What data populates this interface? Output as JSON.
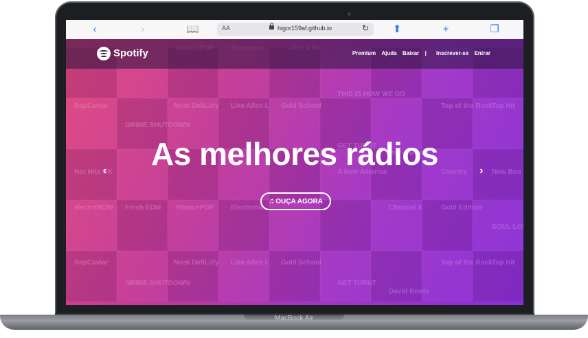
{
  "device": {
    "model_label": "MacBook Air"
  },
  "browser": {
    "back_icon": "chevron-left-icon",
    "forward_icon": "chevron-right-icon",
    "text_size_label": "AA",
    "url": "higor159af.github.io"
  },
  "site": {
    "brand": "Spotify",
    "nav": {
      "premium": "Premium",
      "help": "Ajuda",
      "download": "Baixar",
      "separator": "|",
      "signup": "Inscrever-se",
      "login": "Entrar"
    },
    "headline": "As melhores rádios",
    "cta_label": "OUÇA AGORA",
    "tile_labels": [
      "#dancePOP",
      "Electronic",
      "Afro & Be",
      "RapCaviar",
      "Most DefiLitly",
      "Like Allen I.",
      "Gold School",
      "Top of the Rock",
      "Top Hit",
      "GRIME SHUTDOWN",
      "THIS IS HOW WE DO",
      "GET TURNT",
      "David Bowie",
      "Hot Hits UK",
      "A New America",
      "Country",
      "New Boo",
      "electroNOW",
      "Fresh EDM",
      "#dancePOP",
      "Electronic",
      "Channel X",
      "Gold Edition",
      "SOUL LOUNGE",
      "RapCaviar",
      "Most DefiLitly",
      "Like Allen I.",
      "Gold School",
      "Top of the Rock",
      "Top Hit",
      "GRIME SHUTDOWN",
      "GET TURNT",
      "David Bowie"
    ]
  },
  "colors": {
    "gradient_start": "#e0467e",
    "gradient_end": "#8a2fd8",
    "browser_accent": "#3478f6"
  }
}
